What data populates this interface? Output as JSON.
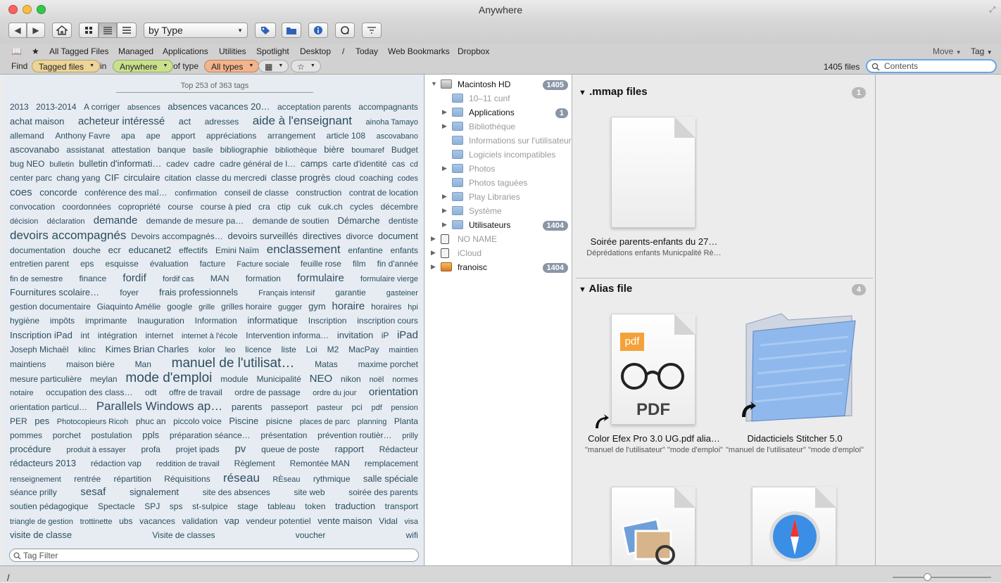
{
  "window": {
    "title": "Anywhere"
  },
  "toolbar": {
    "sort_select": "by Type"
  },
  "favorites": [
    "All Tagged Files",
    "Managed",
    "Applications",
    "Utilities",
    "Spotlight",
    "Desktop",
    "/",
    "Today",
    "Web Bookmarks",
    "Dropbox"
  ],
  "favorites_right": {
    "move": "Move",
    "tag": "Tag"
  },
  "find": {
    "label": "Find",
    "scope": "Tagged files",
    "in": "in",
    "location": "Anywhere",
    "of_type": "of type",
    "type": "All types",
    "files_count": "1405 files",
    "search_placeholder": "Contents"
  },
  "tags": {
    "header": "Top 253 of 363 tags",
    "filter_placeholder": "Tag Filter",
    "lines": [
      [
        [
          "2013",
          2
        ],
        [
          "2013-2014",
          2
        ],
        [
          "A corriger",
          2
        ],
        [
          "absences",
          1
        ],
        [
          "absences vacances 20…",
          3
        ],
        [
          "acceptation parents",
          2
        ],
        [
          "accompagnants",
          2
        ]
      ],
      [
        [
          "achat maison",
          3
        ],
        [
          "acheteur intéressé",
          4
        ],
        [
          "act",
          3
        ],
        [
          "adresses",
          2
        ],
        [
          "aide à l'enseignant",
          5
        ],
        [
          "ainoha Tamayo",
          1
        ]
      ],
      [
        [
          "allemand",
          2
        ],
        [
          "Anthony Favre",
          2
        ],
        [
          "apa",
          2
        ],
        [
          "ape",
          2
        ],
        [
          "apport",
          2
        ],
        [
          "appréciations",
          2
        ],
        [
          "arrangement",
          2
        ],
        [
          "article 108",
          2
        ],
        [
          "ascovabano",
          1
        ]
      ],
      [
        [
          "ascovanabo",
          3
        ],
        [
          "assistanat",
          2
        ],
        [
          "attestation",
          2
        ],
        [
          "banque",
          2
        ],
        [
          "basile",
          1
        ],
        [
          "bibliographie",
          2
        ],
        [
          "bibliothèque",
          1
        ],
        [
          "bière",
          3
        ],
        [
          "boumaref",
          1
        ],
        [
          "Budget",
          2
        ]
      ],
      [
        [
          "bug NEO",
          2
        ],
        [
          "bulletin",
          1
        ],
        [
          "bulletin d'informati…",
          3
        ],
        [
          "cadev",
          2
        ],
        [
          "cadre",
          2
        ],
        [
          "cadre général de l…",
          2
        ],
        [
          "camps",
          3
        ],
        [
          "carte d'identité",
          2
        ],
        [
          "cas",
          2
        ],
        [
          "cd",
          1
        ]
      ],
      [
        [
          "center parc",
          2
        ],
        [
          "chang yang",
          2
        ],
        [
          "CIF",
          3
        ],
        [
          "circulaire",
          3
        ],
        [
          "citation",
          2
        ],
        [
          "classe du mercredi",
          2
        ],
        [
          "classe progrès",
          3
        ],
        [
          "cloud",
          2
        ],
        [
          "coaching",
          2
        ],
        [
          "codes",
          1
        ]
      ],
      [
        [
          "coes",
          4
        ],
        [
          "concorde",
          3
        ],
        [
          "conférence des maî…",
          2
        ],
        [
          "confirmation",
          1
        ],
        [
          "conseil de classe",
          2
        ],
        [
          "construction",
          2
        ],
        [
          "contrat de location",
          2
        ]
      ],
      [
        [
          "convocation",
          2
        ],
        [
          "coordonnées",
          2
        ],
        [
          "copropriété",
          2
        ],
        [
          "course",
          2
        ],
        [
          "course à pied",
          2
        ],
        [
          "cra",
          2
        ],
        [
          "ctip",
          2
        ],
        [
          "cuk",
          2
        ],
        [
          "cuk.ch",
          2
        ],
        [
          "cycles",
          2
        ],
        [
          "décembre",
          2
        ]
      ],
      [
        [
          "décision",
          1
        ],
        [
          "déclaration",
          1
        ],
        [
          "demande",
          4
        ],
        [
          "demande de mesure pa…",
          2
        ],
        [
          "demande de soutien",
          2
        ],
        [
          "Démarche",
          3
        ],
        [
          "dentiste",
          2
        ]
      ],
      [
        [
          "devoirs accompagnés",
          5
        ],
        [
          "Devoirs accompagnés…",
          2
        ],
        [
          "devoirs surveillés",
          3
        ],
        [
          "directives",
          3
        ],
        [
          "divorce",
          2
        ],
        [
          "document",
          3
        ]
      ],
      [
        [
          "documentation",
          2
        ],
        [
          "douche",
          2
        ],
        [
          "ecr",
          3
        ],
        [
          "educanet2",
          3
        ],
        [
          "effectifs",
          2
        ],
        [
          "Emini Naïm",
          2
        ],
        [
          "enclassement",
          5
        ],
        [
          "enfantine",
          2
        ],
        [
          "enfants",
          2
        ]
      ],
      [
        [
          "entretien parent",
          2
        ],
        [
          "eps",
          2
        ],
        [
          "esquisse",
          2
        ],
        [
          "évaluation",
          2
        ],
        [
          "facture",
          2
        ],
        [
          "Facture sociale",
          1
        ],
        [
          "feuille rose",
          2
        ],
        [
          "film",
          2
        ],
        [
          "fin d'année",
          2
        ]
      ],
      [
        [
          "fin de semestre",
          1
        ],
        [
          "finance",
          2
        ],
        [
          "fordif",
          4
        ],
        [
          "fordif cas",
          1
        ],
        [
          "MAN",
          2
        ],
        [
          "formation",
          2
        ],
        [
          "formulaire",
          4
        ],
        [
          "formulaire vierge",
          1
        ]
      ],
      [
        [
          "Fournitures scolaire…",
          3
        ],
        [
          "foyer",
          2
        ],
        [
          "frais professionnels",
          3
        ],
        [
          "Français intensif",
          1
        ],
        [
          "garantie",
          2
        ],
        [
          "gasteiner",
          1
        ]
      ],
      [
        [
          "gestion documentaire",
          2
        ],
        [
          "Giaquinto Amélie",
          2
        ],
        [
          "google",
          2
        ],
        [
          "grille",
          1
        ],
        [
          "grilles horaire",
          2
        ],
        [
          "gugger",
          1
        ],
        [
          "gym",
          3
        ],
        [
          "horaire",
          4
        ],
        [
          "horaires",
          2
        ],
        [
          "hpi",
          1
        ]
      ],
      [
        [
          "hygiène",
          2
        ],
        [
          "impôts",
          2
        ],
        [
          "imprimante",
          2
        ],
        [
          "Inauguration",
          2
        ],
        [
          "Information",
          2
        ],
        [
          "informatique",
          3
        ],
        [
          "Inscription",
          2
        ],
        [
          "inscription cours",
          2
        ]
      ],
      [
        [
          "Inscription iPad",
          3
        ],
        [
          "int",
          2
        ],
        [
          "intégration",
          2
        ],
        [
          "internet",
          2
        ],
        [
          "internet à l'école",
          1
        ],
        [
          "Intervention informa…",
          2
        ],
        [
          "invitation",
          3
        ],
        [
          "iP",
          2
        ],
        [
          "iPad",
          4
        ]
      ],
      [
        [
          "Joseph Michaël",
          2
        ],
        [
          "kilinc",
          1
        ],
        [
          "Kimes Brian Charles",
          3
        ],
        [
          "kolor",
          1
        ],
        [
          "leo",
          1
        ],
        [
          "licence",
          2
        ],
        [
          "liste",
          2
        ],
        [
          "Loi",
          2
        ],
        [
          "M2",
          2
        ],
        [
          "MacPay",
          2
        ],
        [
          "maintien",
          1
        ]
      ],
      [
        [
          "maintiens",
          2
        ],
        [
          "maison bière",
          2
        ],
        [
          "Man",
          2
        ],
        [
          "manuel de l'utilisat…",
          6
        ],
        [
          "Matas",
          2
        ],
        [
          "maxime porchet",
          2
        ]
      ],
      [
        [
          "mesure particulière",
          2
        ],
        [
          "meylan",
          2
        ],
        [
          "mode d'emploi",
          6
        ],
        [
          "module",
          2
        ],
        [
          "Municipalité",
          2
        ],
        [
          "NEO",
          4
        ],
        [
          "nikon",
          2
        ],
        [
          "noël",
          1
        ],
        [
          "normes",
          1
        ]
      ],
      [
        [
          "notaire",
          1
        ],
        [
          "occupation des class…",
          2
        ],
        [
          "odt",
          2
        ],
        [
          "offre de travail",
          2
        ],
        [
          "ordre de passage",
          2
        ],
        [
          "ordre du jour",
          1
        ],
        [
          "orientation",
          4
        ]
      ],
      [
        [
          "orientation particul…",
          2
        ],
        [
          "Parallels Windows ap…",
          5
        ],
        [
          "parents",
          3
        ],
        [
          "passeport",
          2
        ],
        [
          "pasteur",
          1
        ],
        [
          "pci",
          2
        ],
        [
          "pdf",
          1
        ],
        [
          "pension",
          1
        ]
      ],
      [
        [
          "PER",
          2
        ],
        [
          "pes",
          3
        ],
        [
          "Photocopieurs Ricoh",
          1
        ],
        [
          "phuc an",
          2
        ],
        [
          "piccolo voice",
          2
        ],
        [
          "Piscine",
          3
        ],
        [
          "pisicne",
          2
        ],
        [
          "places de parc",
          1
        ],
        [
          "planning",
          1
        ],
        [
          "Planta",
          2
        ]
      ],
      [
        [
          "pommes",
          2
        ],
        [
          "porchet",
          2
        ],
        [
          "postulation",
          2
        ],
        [
          "ppls",
          3
        ],
        [
          "préparation séance…",
          2
        ],
        [
          "présentation",
          2
        ],
        [
          "prévention routièr…",
          2
        ],
        [
          "prilly",
          1
        ]
      ],
      [
        [
          "procédure",
          3
        ],
        [
          "produit à essayer",
          1
        ],
        [
          "profa",
          2
        ],
        [
          "projet ipads",
          2
        ],
        [
          "pv",
          4
        ],
        [
          "queue de poste",
          2
        ],
        [
          "rapport",
          3
        ],
        [
          "Rédacteur",
          2
        ]
      ],
      [
        [
          "rédacteurs 2013",
          3
        ],
        [
          "rédaction vap",
          2
        ],
        [
          "reddition de travail",
          1
        ],
        [
          "Règlement",
          2
        ],
        [
          "Remontée MAN",
          2
        ],
        [
          "remplacement",
          2
        ]
      ],
      [
        [
          "renseignement",
          1
        ],
        [
          "rentrée",
          2
        ],
        [
          "répartition",
          2
        ],
        [
          "Réquisitions",
          2
        ],
        [
          "réseau",
          5
        ],
        [
          "RÈseau",
          1
        ],
        [
          "rythmique",
          2
        ],
        [
          "salle spéciale",
          3
        ]
      ],
      [
        [
          "séance prilly",
          2
        ],
        [
          "sesaf",
          4
        ],
        [
          "signalement",
          3
        ],
        [
          "site des absences",
          2
        ],
        [
          "site web",
          2
        ],
        [
          "soirée des parents",
          2
        ]
      ],
      [
        [
          "soutien pédagogique",
          2
        ],
        [
          "Spectacle",
          2
        ],
        [
          "SPJ",
          2
        ],
        [
          "sps",
          2
        ],
        [
          "st-sulpice",
          2
        ],
        [
          "stage",
          2
        ],
        [
          "tableau",
          2
        ],
        [
          "token",
          2
        ],
        [
          "traduction",
          3
        ],
        [
          "transport",
          2
        ]
      ],
      [
        [
          "triangle de gestion",
          1
        ],
        [
          "trottinette",
          1
        ],
        [
          "ubs",
          2
        ],
        [
          "vacances",
          2
        ],
        [
          "validation",
          2
        ],
        [
          "vap",
          3
        ],
        [
          "vendeur potentiel",
          2
        ],
        [
          "vente maison",
          3
        ],
        [
          "Vidal",
          2
        ],
        [
          "visa",
          1
        ]
      ],
      [
        [
          "visite de classe",
          3
        ],
        [
          "Visite de classes",
          2
        ],
        [
          "voucher",
          2
        ],
        [
          "wifi",
          2
        ]
      ]
    ]
  },
  "tree": [
    {
      "label": "Macintosh HD",
      "badge": "1405",
      "indent": 0,
      "disc": "down",
      "kind": "disk",
      "dim": false
    },
    {
      "label": "10–11 cunf",
      "badge": "",
      "indent": 1,
      "disc": "",
      "kind": "folder",
      "dim": true
    },
    {
      "label": "Applications",
      "badge": "1",
      "indent": 1,
      "disc": "right",
      "kind": "folder",
      "dim": false
    },
    {
      "label": "Bibliothèque",
      "badge": "",
      "indent": 1,
      "disc": "right",
      "kind": "folder",
      "dim": true
    },
    {
      "label": "Informations sur l'utilisateur",
      "badge": "",
      "indent": 1,
      "disc": "",
      "kind": "alias",
      "dim": true
    },
    {
      "label": "Logiciels incompatibles",
      "badge": "",
      "indent": 1,
      "disc": "",
      "kind": "folder",
      "dim": true
    },
    {
      "label": "Photos",
      "badge": "",
      "indent": 1,
      "disc": "right",
      "kind": "folder",
      "dim": true
    },
    {
      "label": "Photos taguées",
      "badge": "",
      "indent": 1,
      "disc": "",
      "kind": "folder",
      "dim": true
    },
    {
      "label": "Play Libraries",
      "badge": "",
      "indent": 1,
      "disc": "right",
      "kind": "folder",
      "dim": true
    },
    {
      "label": "Système",
      "badge": "",
      "indent": 1,
      "disc": "right",
      "kind": "folder",
      "dim": true
    },
    {
      "label": "Utilisateurs",
      "badge": "1404",
      "indent": 1,
      "disc": "right",
      "kind": "folder",
      "dim": false
    },
    {
      "label": "NO NAME",
      "badge": "",
      "indent": 0,
      "disc": "right",
      "kind": "drive",
      "dim": true
    },
    {
      "label": "iCloud",
      "badge": "",
      "indent": 0,
      "disc": "right",
      "kind": "drive",
      "dim": true
    },
    {
      "label": "franoisc",
      "badge": "1404",
      "indent": 0,
      "disc": "right",
      "kind": "home",
      "dim": false
    }
  ],
  "groups": [
    {
      "title": ".mmap files",
      "count": "1",
      "files": [
        {
          "name": "Soirée parents-enfants du 27…",
          "sub": "Déprédations enfants Municpalité Rè…",
          "kind": "blank"
        }
      ]
    },
    {
      "title": "Alias file",
      "count": "4",
      "files": [
        {
          "name": "Color Efex Pro 3.0 UG.pdf alia…",
          "sub": "\"manuel de l'utilisateur\" \"mode d'emploi\"",
          "kind": "pdf",
          "icon_text": "PDF",
          "badge_text": "pdf"
        },
        {
          "name": "Didacticiels Stitcher 5.0",
          "sub": "\"manuel de l'utilisateur\" \"mode d'emploi\"",
          "kind": "folder"
        }
      ]
    }
  ],
  "status": {
    "path": "/"
  }
}
